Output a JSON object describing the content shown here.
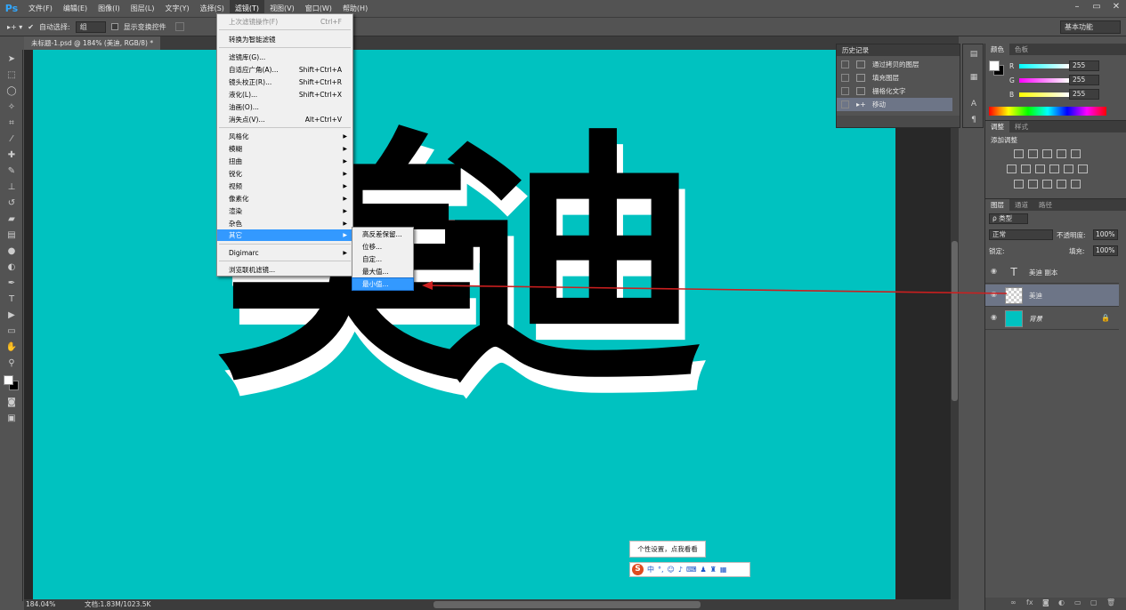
{
  "app": {
    "logo": "Ps",
    "menu": [
      "文件(F)",
      "编辑(E)",
      "图像(I)",
      "图层(L)",
      "文字(Y)",
      "选择(S)",
      "滤镜(T)",
      "视图(V)",
      "窗口(W)",
      "帮助(H)"
    ],
    "window_controls": [
      "–",
      "▭",
      "✕"
    ]
  },
  "options_bar": {
    "auto_select_label": "自动选择:",
    "auto_select_value": "组",
    "show_transform_label": "显示变换控件",
    "workspace": "基本功能"
  },
  "document": {
    "tab_title": "未标题-1.psd @ 184% (美迪, RGB/8) *",
    "text_chars": [
      "美",
      "迪"
    ],
    "canvas_color": "#00c2c0"
  },
  "status": {
    "zoom": "184.04%",
    "doc_size": "文档:1.83M/1023.5K"
  },
  "filter_menu": {
    "items": [
      {
        "label": "上次滤镜操作(F)",
        "shortcut": "Ctrl+F",
        "disabled": true
      },
      {
        "label": "转换为智能滤镜",
        "shortcut": ""
      },
      {
        "label": "滤镜库(G)...",
        "shortcut": ""
      },
      {
        "label": "自适应广角(A)...",
        "shortcut": "Shift+Ctrl+A"
      },
      {
        "label": "镜头校正(R)...",
        "shortcut": "Shift+Ctrl+R"
      },
      {
        "label": "液化(L)...",
        "shortcut": "Shift+Ctrl+X"
      },
      {
        "label": "油画(O)...",
        "shortcut": ""
      },
      {
        "label": "消失点(V)...",
        "shortcut": "Alt+Ctrl+V"
      },
      {
        "label": "风格化",
        "sub": true
      },
      {
        "label": "模糊",
        "sub": true
      },
      {
        "label": "扭曲",
        "sub": true
      },
      {
        "label": "锐化",
        "sub": true
      },
      {
        "label": "视频",
        "sub": true
      },
      {
        "label": "像素化",
        "sub": true
      },
      {
        "label": "渲染",
        "sub": true
      },
      {
        "label": "杂色",
        "sub": true
      },
      {
        "label": "其它",
        "sub": true,
        "highlighted": true
      },
      {
        "label": "Digimarc",
        "sub": true
      },
      {
        "label": "浏览联机滤镜...",
        "shortcut": ""
      }
    ],
    "submenu": [
      "高反差保留...",
      "位移...",
      "自定...",
      "最大值...",
      "最小值..."
    ]
  },
  "history_panel": {
    "title": "历史记录",
    "items": [
      "通过拷贝的图层",
      "填充图层",
      "栅格化文字",
      "移动"
    ]
  },
  "color_panel": {
    "tabs": [
      "颜色",
      "色板"
    ],
    "channels": [
      {
        "label": "R",
        "value": "255"
      },
      {
        "label": "G",
        "value": "255"
      },
      {
        "label": "B",
        "value": "255"
      }
    ]
  },
  "adjust_panel": {
    "tabs": [
      "调整",
      "样式"
    ],
    "title": "添加调整"
  },
  "layers_panel": {
    "tabs": [
      "图层",
      "通道",
      "路径"
    ],
    "filter_label": "ρ 类型",
    "blend_mode": "正常",
    "opacity_label": "不透明度:",
    "opacity_value": "100%",
    "lock_label": "锁定:",
    "fill_label": "填充:",
    "fill_value": "100%",
    "layers": [
      {
        "name": "美迪 副本",
        "type": "text"
      },
      {
        "name": "美迪",
        "type": "pixel",
        "selected": true
      },
      {
        "name": "背景",
        "type": "background",
        "locked": true
      }
    ]
  },
  "ime": {
    "tooltip": "个性设置，点我看看",
    "lang": "中"
  },
  "annotation": {
    "arrow_color": "#cc1f1f"
  }
}
